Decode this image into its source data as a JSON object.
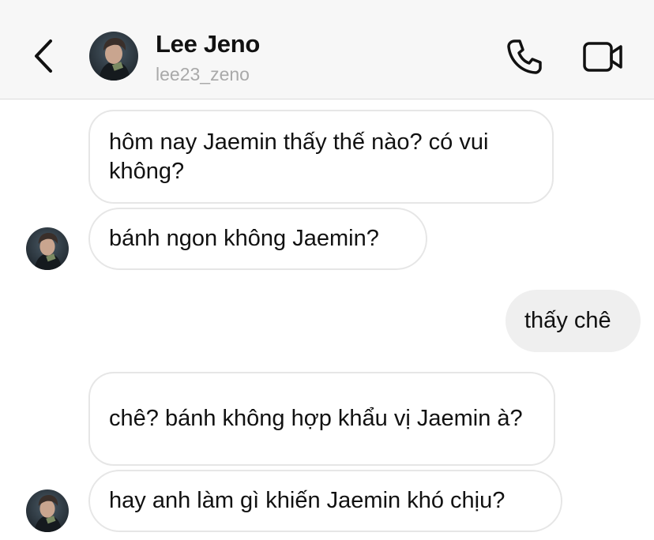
{
  "header": {
    "name": "Lee Jeno",
    "handle": "lee23_zeno",
    "back_icon": "chevron-left-icon",
    "call_icon": "phone-icon",
    "video_icon": "video-camera-icon"
  },
  "messages": [
    {
      "from": "them",
      "text": "hôm nay Jaemin thấy thế nào? có vui không?"
    },
    {
      "from": "them",
      "text": "bánh ngon không Jaemin?"
    },
    {
      "from": "me",
      "text": "thấy chê"
    },
    {
      "from": "them",
      "text": "chê? bánh không hợp khẩu vị Jaemin à?"
    },
    {
      "from": "them",
      "text": "hay anh làm gì khiến Jaemin khó chịu?"
    }
  ],
  "colors": {
    "header_bg": "#f7f7f7",
    "incoming_bubble_border": "#e6e6e6",
    "outgoing_bubble_bg": "#efefef",
    "text": "#111111",
    "handle_text": "#a9a9a9"
  }
}
